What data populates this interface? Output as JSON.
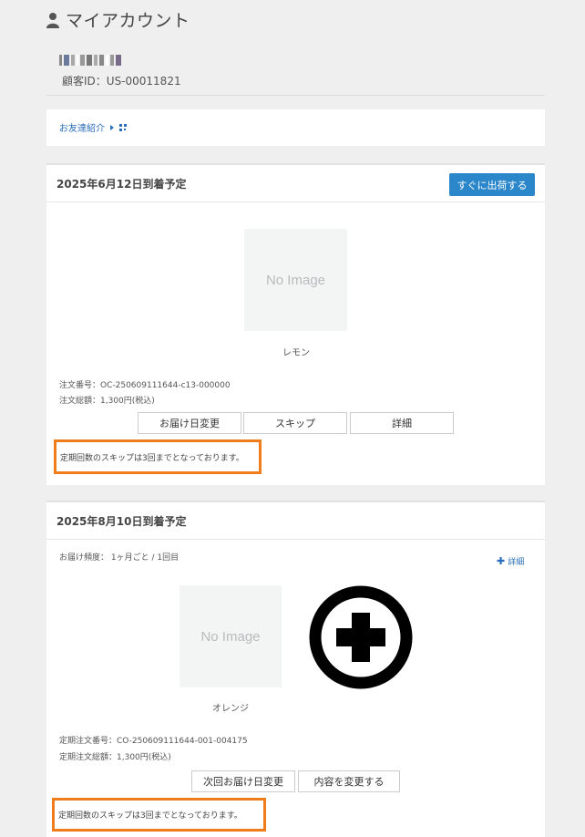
{
  "page": {
    "title": "マイアカウント"
  },
  "account": {
    "customer_id": "顧客ID：US-00011821"
  },
  "referral": {
    "label": "お友達紹介"
  },
  "orders": [
    {
      "date": "2025年6月12日到着予定",
      "ship_now_label": "すぐに出荷する",
      "image_placeholder": "No Image",
      "product": "レモン",
      "order_number": "注文番号：OC-250609111644-c13-000000",
      "order_total": "注文総額：1,300円(税込)",
      "buttons": [
        "お届け日変更",
        "スキップ",
        "詳細"
      ],
      "notice": "定期回数のスキップは3回までとなっております。"
    },
    {
      "date": "2025年8月10日到着予定",
      "frequency": "お届け頻度： 1ヶ月ごと / 1回目",
      "detail_label": "詳細",
      "image_placeholder": "No Image",
      "product": "オレンジ",
      "order_number": "定期注文番号：CO-250609111644-001-004175",
      "order_total": "定期注文総額：1,300円(税込)",
      "buttons": [
        "次回お届け日変更",
        "内容を変更する"
      ],
      "notice": "定期回数のスキップは3回までとなっております。"
    }
  ],
  "colors": {
    "accent": "#2b87c9",
    "highlight": "#f07d1b",
    "link": "#2a6ebb"
  },
  "icons": {
    "title": "user-icon",
    "referral": "qr-code-icon",
    "add": "add-circle-icon"
  }
}
